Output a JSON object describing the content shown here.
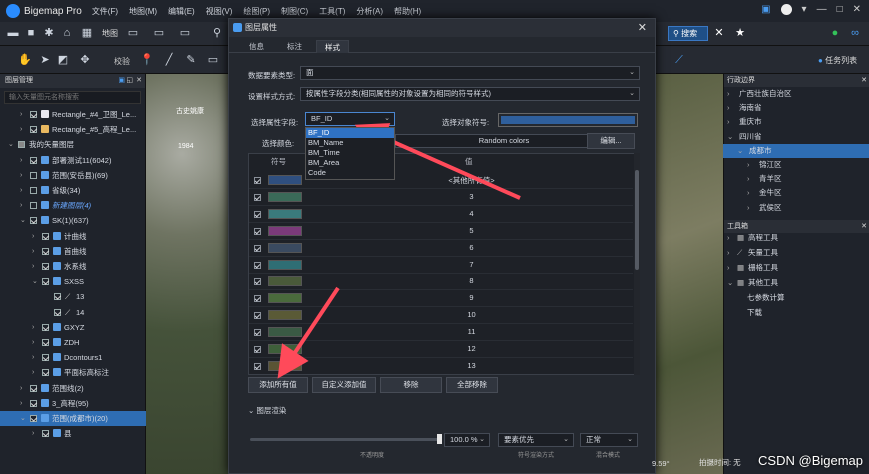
{
  "app": {
    "name": "Bigemap Pro",
    "menus": [
      "文件(F)",
      "地图(M)",
      "编辑(E)",
      "视图(V)",
      "绘图(P)",
      "制图(C)",
      "工具(T)",
      "分析(A)",
      "帮助(H)"
    ]
  },
  "toolbar": {
    "map_label": "地图",
    "check_label": "校验",
    "search_label": "搜索",
    "task_list_label": "任务列表"
  },
  "layer_panel": {
    "title": "图层管理",
    "search_placeholder": "输入矢量图元名称搜索",
    "items": [
      {
        "label": "Rectangle_#4_卫图_Le..."
      },
      {
        "label": "Rectangle_#5_高程_Le..."
      },
      {
        "label": "我的矢量图层"
      },
      {
        "label": "部署测试11(6042)"
      },
      {
        "label": "范围(安岳县)(69)"
      },
      {
        "label": "省级(34)"
      },
      {
        "label": "新建图层(4)"
      },
      {
        "label": "SK(1)(637)"
      },
      {
        "label": "计曲线"
      },
      {
        "label": "首曲线"
      },
      {
        "label": "水系线"
      },
      {
        "label": "SXSS"
      },
      {
        "label": "13"
      },
      {
        "label": "14"
      },
      {
        "label": "GXYZ"
      },
      {
        "label": "ZDH"
      },
      {
        "label": "Dcontours1"
      },
      {
        "label": "平面标高标注"
      },
      {
        "label": "范围线(2)"
      },
      {
        "label": "3_高程(95)"
      },
      {
        "label": "范围(成都市)(20)"
      },
      {
        "label": "县"
      }
    ]
  },
  "dialog": {
    "title": "图层属性",
    "tabs": [
      "信息",
      "标注",
      "样式"
    ],
    "data_type_label": "数据要素类型:",
    "data_type_value": "面",
    "style_mode_label": "设置样式方式:",
    "style_mode_value": "按属性字段分类(相同属性的对象设置为相同的符号样式)",
    "field_label": "选择属性字段:",
    "field_value": "BF_ID",
    "symbol_label": "选择对象符号:",
    "color_label": "选择颜色:",
    "color_value": "Random colors",
    "edit_button": "编辑...",
    "field_options": [
      "BF_ID",
      "BM_Name",
      "BM_Time",
      "BM_Area",
      "Code"
    ],
    "col_symbol": "符号",
    "col_value": "值",
    "rows": [
      {
        "value": "<其他所有值>",
        "color": "#2f4f7f"
      },
      {
        "value": "3",
        "color": "#3a6a58"
      },
      {
        "value": "4",
        "color": "#3a7a7c"
      },
      {
        "value": "5",
        "color": "#7b3a7a"
      },
      {
        "value": "6",
        "color": "#3a4a60"
      },
      {
        "value": "7",
        "color": "#2f6e74"
      },
      {
        "value": "8",
        "color": "#4a5a3a"
      },
      {
        "value": "9",
        "color": "#4a6a3c"
      },
      {
        "value": "10",
        "color": "#5a5a36"
      },
      {
        "value": "11",
        "color": "#3a5a44"
      },
      {
        "value": "12",
        "color": "#3e5f3a"
      },
      {
        "value": "13",
        "color": "#5a5434"
      }
    ],
    "add_all_button": "添加所有值",
    "custom_add_button": "自定义添加值",
    "remove_button": "移除",
    "remove_all_button": "全部移除",
    "render_section": "图层渲染",
    "opacity_value": "100.0 %",
    "opacity_label": "不透明度",
    "priority_value": "要素优先",
    "priority_label": "符号渲染方式",
    "mix_value": "正常",
    "mix_label": "混合模式"
  },
  "right_panel": {
    "boundary_title": "行政边界",
    "boundary_items": [
      "广西壮族自治区",
      "海南省",
      "重庆市",
      "四川省",
      "成都市",
      "锦江区",
      "青羊区",
      "金牛区",
      "武侯区"
    ],
    "toolbox_title": "工具箱",
    "toolbox_items": [
      "高程工具",
      "矢量工具",
      "栅格工具",
      "其他工具",
      "七参数计算",
      "下载"
    ]
  },
  "map_labels": {
    "place1": "古史姚康",
    "place2": "1984"
  },
  "status": {
    "coord_left": "9.59°",
    "coord_mid": "拍摄时间: 无",
    "watermark": "CSDN @Bigemap"
  }
}
